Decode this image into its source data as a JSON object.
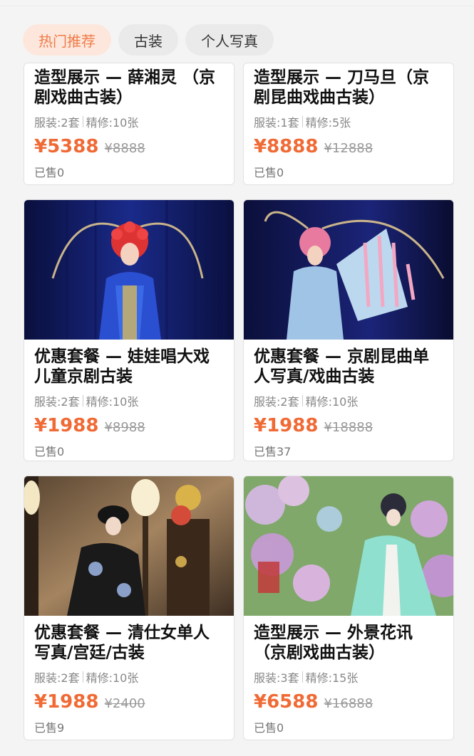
{
  "tabs": [
    "热门推荐",
    "古装",
    "个人写真"
  ],
  "cards": [
    {
      "title": "造型展示 — 薛湘灵 （京剧戏曲古装）",
      "meta_a": "服装:2套",
      "meta_b": "精修:10张",
      "price": "¥5388",
      "orig": "¥8888",
      "sold": "已售0"
    },
    {
      "title": "造型展示 — 刀马旦（京剧昆曲戏曲古装）",
      "meta_a": "服装:1套",
      "meta_b": "精修:5张",
      "price": "¥8888",
      "orig": "¥12888",
      "sold": "已售0"
    },
    {
      "title": "优惠套餐 — 娃娃唱大戏 儿童京剧古装",
      "meta_a": "服装:2套",
      "meta_b": "精修:10张",
      "price": "¥1988",
      "orig": "¥8988",
      "sold": "已售0",
      "image": "child-opera-photo"
    },
    {
      "title": "优惠套餐 — 京剧昆曲单人写真/戏曲古装",
      "meta_a": "服装:2套",
      "meta_b": "精修:10张",
      "price": "¥1988",
      "orig": "¥18888",
      "sold": "已售37",
      "image": "opera-warrior-photo"
    },
    {
      "title": "优惠套餐 — 清仕女单人写真/宫廷/古装",
      "meta_a": "服装:2套",
      "meta_b": "精修:10张",
      "price": "¥1988",
      "orig": "¥2400",
      "sold": "已售9",
      "image": "qing-lady-photo"
    },
    {
      "title": "造型展示 — 外景花讯（京剧戏曲古装）",
      "meta_a": "服装:3套",
      "meta_b": "精修:15张",
      "price": "¥6588",
      "orig": "¥16888",
      "sold": "已售0",
      "image": "garden-flowers-photo"
    }
  ]
}
